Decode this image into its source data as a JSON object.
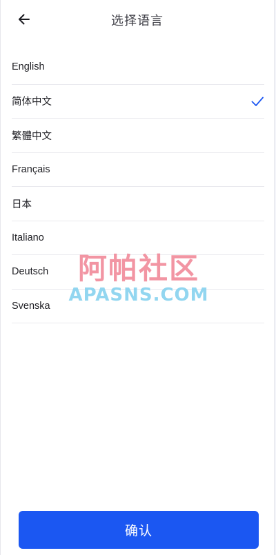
{
  "header": {
    "title": "选择语言",
    "back_icon": "arrow-left-icon"
  },
  "languages": [
    {
      "label": "English",
      "selected": false
    },
    {
      "label": "简体中文",
      "selected": true
    },
    {
      "label": "繁體中文",
      "selected": false
    },
    {
      "label": "Français",
      "selected": false
    },
    {
      "label": "日本",
      "selected": false
    },
    {
      "label": "Italiano",
      "selected": false
    },
    {
      "label": "Deutsch",
      "selected": false
    },
    {
      "label": "Svenska",
      "selected": false
    }
  ],
  "check_icon": "checkmark-icon",
  "watermark": {
    "cn": "阿帕社区",
    "en": "APASNS.COM"
  },
  "confirm_label": "确认",
  "colors": {
    "accent": "#1b57f2",
    "check": "#1b57f2",
    "watermark_cn": "#f08394",
    "watermark_en": "#7fd0ee"
  }
}
